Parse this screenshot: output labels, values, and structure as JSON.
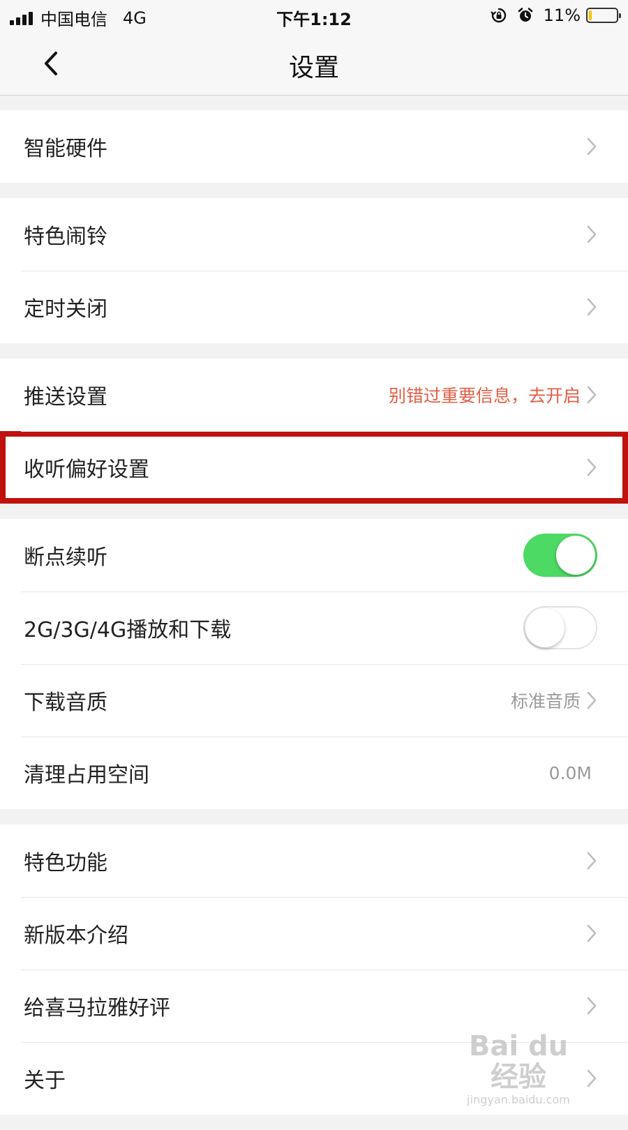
{
  "status_bar": {
    "carrier": "中国电信",
    "network": "4G",
    "time": "下午1:12",
    "battery_percent": "11%",
    "battery_level": 0.11,
    "icons": [
      "signal-icon",
      "rotation-lock-icon",
      "alarm-icon",
      "battery-icon"
    ]
  },
  "nav": {
    "title": "设置",
    "back_icon": "chevron-left-icon"
  },
  "groups": [
    {
      "items": [
        {
          "label": "智能硬件"
        }
      ]
    },
    {
      "items": [
        {
          "label": "特色闹铃"
        },
        {
          "label": "定时关闭"
        }
      ]
    },
    {
      "items": [
        {
          "label": "推送设置",
          "value": "别错过重要信息，去开启"
        },
        {
          "label": "收听偏好设置",
          "highlighted": true
        }
      ]
    },
    {
      "items": [
        {
          "label": "断点续听",
          "toggle": true
        },
        {
          "label": "2G/3G/4G播放和下载",
          "toggle": false
        },
        {
          "label": "下载音质",
          "value": "标准音质"
        },
        {
          "label": "清理占用空间",
          "value": "0.0M"
        }
      ]
    },
    {
      "items": [
        {
          "label": "特色功能"
        },
        {
          "label": "新版本介绍"
        },
        {
          "label": "给喜马拉雅好评"
        },
        {
          "label": "关于"
        }
      ]
    }
  ],
  "colors": {
    "toggle_on": "#4cd964",
    "warning_text": "#e45d47",
    "highlight_box": "#c0110c",
    "battery_fill": "#f5c400"
  },
  "watermark": {
    "logo_text": "Bai du 经验",
    "url": "jingyan.baidu.com"
  }
}
